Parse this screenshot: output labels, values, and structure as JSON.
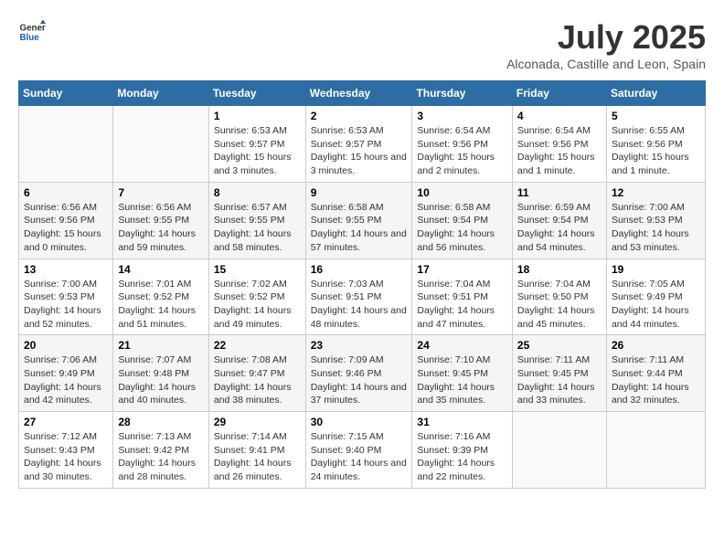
{
  "logo": {
    "general": "General",
    "blue": "Blue"
  },
  "title": "July 2025",
  "subtitle": "Alconada, Castille and Leon, Spain",
  "headers": [
    "Sunday",
    "Monday",
    "Tuesday",
    "Wednesday",
    "Thursday",
    "Friday",
    "Saturday"
  ],
  "weeks": [
    [
      {
        "day": "",
        "sunrise": "",
        "sunset": "",
        "daylight": ""
      },
      {
        "day": "",
        "sunrise": "",
        "sunset": "",
        "daylight": ""
      },
      {
        "day": "1",
        "sunrise": "Sunrise: 6:53 AM",
        "sunset": "Sunset: 9:57 PM",
        "daylight": "Daylight: 15 hours and 3 minutes."
      },
      {
        "day": "2",
        "sunrise": "Sunrise: 6:53 AM",
        "sunset": "Sunset: 9:57 PM",
        "daylight": "Daylight: 15 hours and 3 minutes."
      },
      {
        "day": "3",
        "sunrise": "Sunrise: 6:54 AM",
        "sunset": "Sunset: 9:56 PM",
        "daylight": "Daylight: 15 hours and 2 minutes."
      },
      {
        "day": "4",
        "sunrise": "Sunrise: 6:54 AM",
        "sunset": "Sunset: 9:56 PM",
        "daylight": "Daylight: 15 hours and 1 minute."
      },
      {
        "day": "5",
        "sunrise": "Sunrise: 6:55 AM",
        "sunset": "Sunset: 9:56 PM",
        "daylight": "Daylight: 15 hours and 1 minute."
      }
    ],
    [
      {
        "day": "6",
        "sunrise": "Sunrise: 6:56 AM",
        "sunset": "Sunset: 9:56 PM",
        "daylight": "Daylight: 15 hours and 0 minutes."
      },
      {
        "day": "7",
        "sunrise": "Sunrise: 6:56 AM",
        "sunset": "Sunset: 9:55 PM",
        "daylight": "Daylight: 14 hours and 59 minutes."
      },
      {
        "day": "8",
        "sunrise": "Sunrise: 6:57 AM",
        "sunset": "Sunset: 9:55 PM",
        "daylight": "Daylight: 14 hours and 58 minutes."
      },
      {
        "day": "9",
        "sunrise": "Sunrise: 6:58 AM",
        "sunset": "Sunset: 9:55 PM",
        "daylight": "Daylight: 14 hours and 57 minutes."
      },
      {
        "day": "10",
        "sunrise": "Sunrise: 6:58 AM",
        "sunset": "Sunset: 9:54 PM",
        "daylight": "Daylight: 14 hours and 56 minutes."
      },
      {
        "day": "11",
        "sunrise": "Sunrise: 6:59 AM",
        "sunset": "Sunset: 9:54 PM",
        "daylight": "Daylight: 14 hours and 54 minutes."
      },
      {
        "day": "12",
        "sunrise": "Sunrise: 7:00 AM",
        "sunset": "Sunset: 9:53 PM",
        "daylight": "Daylight: 14 hours and 53 minutes."
      }
    ],
    [
      {
        "day": "13",
        "sunrise": "Sunrise: 7:00 AM",
        "sunset": "Sunset: 9:53 PM",
        "daylight": "Daylight: 14 hours and 52 minutes."
      },
      {
        "day": "14",
        "sunrise": "Sunrise: 7:01 AM",
        "sunset": "Sunset: 9:52 PM",
        "daylight": "Daylight: 14 hours and 51 minutes."
      },
      {
        "day": "15",
        "sunrise": "Sunrise: 7:02 AM",
        "sunset": "Sunset: 9:52 PM",
        "daylight": "Daylight: 14 hours and 49 minutes."
      },
      {
        "day": "16",
        "sunrise": "Sunrise: 7:03 AM",
        "sunset": "Sunset: 9:51 PM",
        "daylight": "Daylight: 14 hours and 48 minutes."
      },
      {
        "day": "17",
        "sunrise": "Sunrise: 7:04 AM",
        "sunset": "Sunset: 9:51 PM",
        "daylight": "Daylight: 14 hours and 47 minutes."
      },
      {
        "day": "18",
        "sunrise": "Sunrise: 7:04 AM",
        "sunset": "Sunset: 9:50 PM",
        "daylight": "Daylight: 14 hours and 45 minutes."
      },
      {
        "day": "19",
        "sunrise": "Sunrise: 7:05 AM",
        "sunset": "Sunset: 9:49 PM",
        "daylight": "Daylight: 14 hours and 44 minutes."
      }
    ],
    [
      {
        "day": "20",
        "sunrise": "Sunrise: 7:06 AM",
        "sunset": "Sunset: 9:49 PM",
        "daylight": "Daylight: 14 hours and 42 minutes."
      },
      {
        "day": "21",
        "sunrise": "Sunrise: 7:07 AM",
        "sunset": "Sunset: 9:48 PM",
        "daylight": "Daylight: 14 hours and 40 minutes."
      },
      {
        "day": "22",
        "sunrise": "Sunrise: 7:08 AM",
        "sunset": "Sunset: 9:47 PM",
        "daylight": "Daylight: 14 hours and 38 minutes."
      },
      {
        "day": "23",
        "sunrise": "Sunrise: 7:09 AM",
        "sunset": "Sunset: 9:46 PM",
        "daylight": "Daylight: 14 hours and 37 minutes."
      },
      {
        "day": "24",
        "sunrise": "Sunrise: 7:10 AM",
        "sunset": "Sunset: 9:45 PM",
        "daylight": "Daylight: 14 hours and 35 minutes."
      },
      {
        "day": "25",
        "sunrise": "Sunrise: 7:11 AM",
        "sunset": "Sunset: 9:45 PM",
        "daylight": "Daylight: 14 hours and 33 minutes."
      },
      {
        "day": "26",
        "sunrise": "Sunrise: 7:11 AM",
        "sunset": "Sunset: 9:44 PM",
        "daylight": "Daylight: 14 hours and 32 minutes."
      }
    ],
    [
      {
        "day": "27",
        "sunrise": "Sunrise: 7:12 AM",
        "sunset": "Sunset: 9:43 PM",
        "daylight": "Daylight: 14 hours and 30 minutes."
      },
      {
        "day": "28",
        "sunrise": "Sunrise: 7:13 AM",
        "sunset": "Sunset: 9:42 PM",
        "daylight": "Daylight: 14 hours and 28 minutes."
      },
      {
        "day": "29",
        "sunrise": "Sunrise: 7:14 AM",
        "sunset": "Sunset: 9:41 PM",
        "daylight": "Daylight: 14 hours and 26 minutes."
      },
      {
        "day": "30",
        "sunrise": "Sunrise: 7:15 AM",
        "sunset": "Sunset: 9:40 PM",
        "daylight": "Daylight: 14 hours and 24 minutes."
      },
      {
        "day": "31",
        "sunrise": "Sunrise: 7:16 AM",
        "sunset": "Sunset: 9:39 PM",
        "daylight": "Daylight: 14 hours and 22 minutes."
      },
      {
        "day": "",
        "sunrise": "",
        "sunset": "",
        "daylight": ""
      },
      {
        "day": "",
        "sunrise": "",
        "sunset": "",
        "daylight": ""
      }
    ]
  ]
}
